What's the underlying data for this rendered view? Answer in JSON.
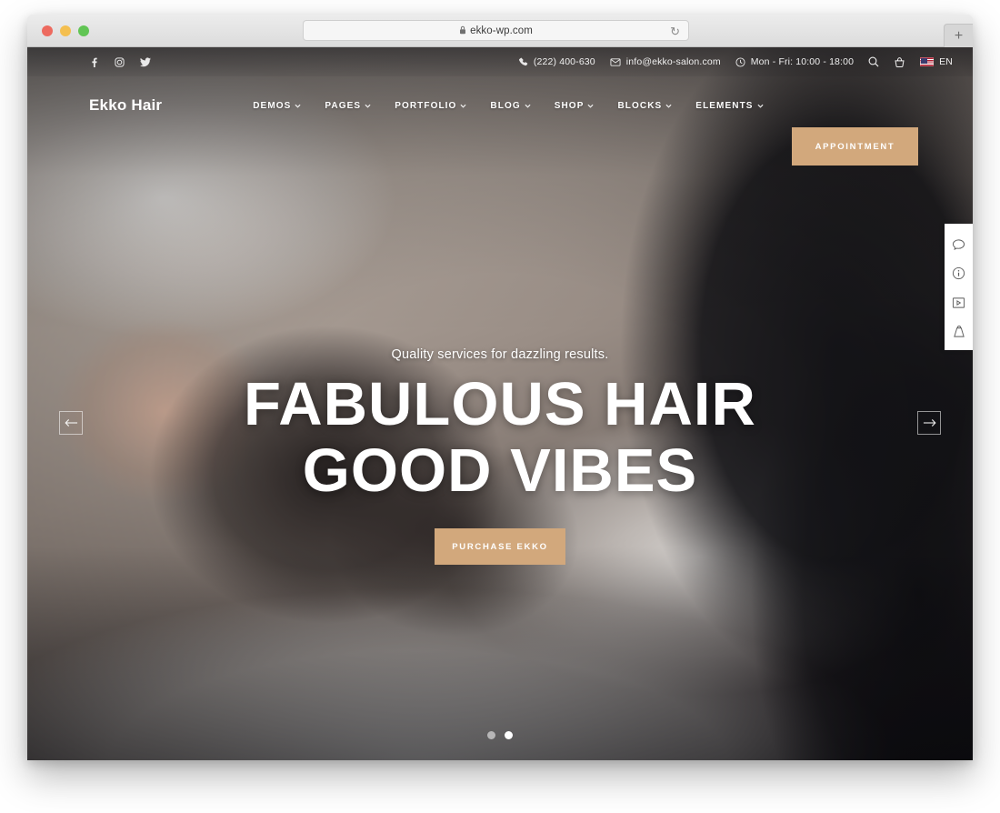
{
  "browser": {
    "url": "ekko-wp.com",
    "lock_icon": "lock-icon",
    "reload_icon": "reload-icon",
    "new_tab_label": "+",
    "traffic_lights": [
      "close",
      "minimize",
      "maximize"
    ]
  },
  "topbar": {
    "social": [
      {
        "name": "facebook-icon",
        "label": "f"
      },
      {
        "name": "instagram-icon",
        "label": ""
      },
      {
        "name": "twitter-icon",
        "label": ""
      }
    ],
    "phone": "(222) 400-630",
    "email": "info@ekko-salon.com",
    "hours": "Mon - Fri: 10:00 - 18:00",
    "search_icon": "search-icon",
    "cart_icon": "basket-icon",
    "language": "EN",
    "flag": "us-flag"
  },
  "nav": {
    "logo": "Ekko Hair",
    "items": [
      {
        "label": "DEMOS",
        "caret": "⌄"
      },
      {
        "label": "PAGES",
        "caret": "⌄"
      },
      {
        "label": "PORTFOLIO",
        "caret": "⌄"
      },
      {
        "label": "BLOG",
        "caret": "⌄"
      },
      {
        "label": "SHOP",
        "caret": "⌄"
      },
      {
        "label": "BLOCKS",
        "caret": "⌄"
      },
      {
        "label": "ELEMENTS",
        "caret": "⌄"
      }
    ],
    "appointment_label": "APPOINTMENT",
    "accent_color": "#d2a87c"
  },
  "hero": {
    "subtitle": "Quality services for dazzling results.",
    "title_line1": "FABULOUS HAIR",
    "title_line2": "GOOD VIBES",
    "cta_label": "PURCHASE EKKO",
    "prev_arrow": "←",
    "next_arrow": "→",
    "dots": [
      {
        "active": false
      },
      {
        "active": true
      }
    ]
  },
  "side_toolbar": {
    "items": [
      {
        "name": "chat-bubble-icon"
      },
      {
        "name": "info-circle-icon"
      },
      {
        "name": "video-play-icon"
      },
      {
        "name": "shopping-bag-icon"
      }
    ]
  }
}
